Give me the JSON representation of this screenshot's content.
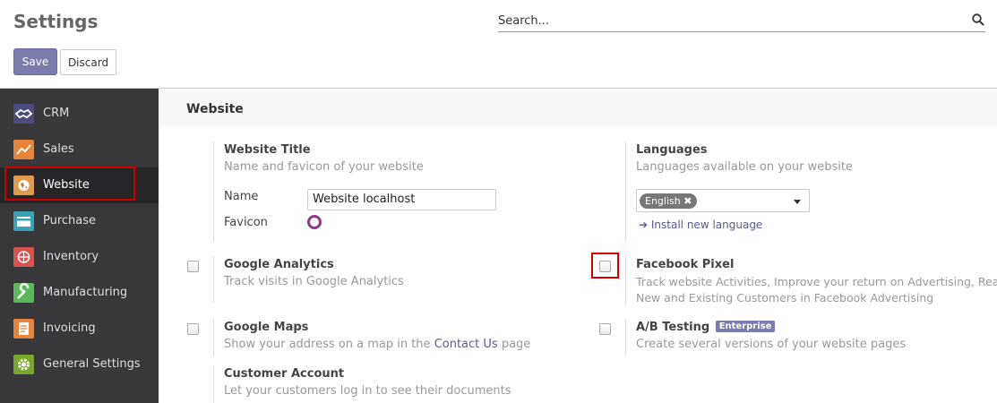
{
  "header": {
    "title": "Settings",
    "search_placeholder": "Search...",
    "save_label": "Save",
    "discard_label": "Discard"
  },
  "sidebar": {
    "items": [
      {
        "label": "CRM",
        "icon": "handshake-icon",
        "color": "#4c4c7e"
      },
      {
        "label": "Sales",
        "icon": "chart-icon",
        "color": "#e8833a"
      },
      {
        "label": "Website",
        "icon": "globe-icon",
        "color": "#e29b4b",
        "active": true
      },
      {
        "label": "Purchase",
        "icon": "card-icon",
        "color": "#3aa4b5"
      },
      {
        "label": "Inventory",
        "icon": "globe-box-icon",
        "color": "#d9534f"
      },
      {
        "label": "Manufacturing",
        "icon": "wrench-icon",
        "color": "#5cb85c"
      },
      {
        "label": "Invoicing",
        "icon": "document-icon",
        "color": "#e8833a"
      },
      {
        "label": "General Settings",
        "icon": "gear-icon",
        "color": "#7aa829"
      }
    ]
  },
  "main": {
    "section_title": "Website",
    "website_title": {
      "title": "Website Title",
      "desc": "Name and favicon of your website",
      "name_label": "Name",
      "name_value": "Website localhost",
      "favicon_label": "Favicon"
    },
    "languages": {
      "title": "Languages",
      "desc": "Languages available on your website",
      "selected": "English",
      "install_link": "Install new language"
    },
    "google_analytics": {
      "title": "Google Analytics",
      "desc": "Track visits in Google Analytics",
      "checked": false
    },
    "facebook_pixel": {
      "title": "Facebook Pixel",
      "desc_line1": "Track website Activities, Improve your return on Advertising, Reach",
      "desc_line2": "New and Existing Customers in Facebook Advertising",
      "checked": false
    },
    "google_maps": {
      "title": "Google Maps",
      "desc_pre": "Show your address on a map in the",
      "desc_link": "Contact Us",
      "desc_post": "page",
      "checked": false
    },
    "ab_testing": {
      "title": "A/B Testing",
      "badge": "Enterprise",
      "desc": "Create several versions of your website pages",
      "checked": false
    },
    "customer_account": {
      "title": "Customer Account",
      "desc": "Let your customers log in to see their documents"
    }
  }
}
